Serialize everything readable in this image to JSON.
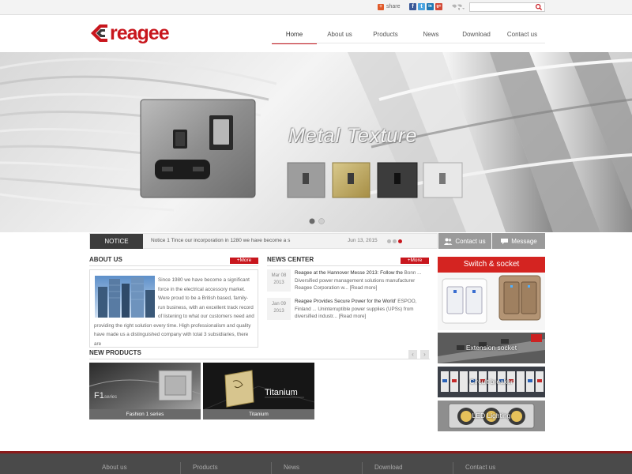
{
  "topbar": {
    "share_label": "share",
    "social": [
      {
        "name": "facebook",
        "glyph": "f",
        "color": "#3b5998"
      },
      {
        "name": "twitter",
        "glyph": "t",
        "color": "#4aa3df"
      },
      {
        "name": "linkedin",
        "glyph": "in",
        "color": "#1f78b4"
      },
      {
        "name": "google-plus",
        "glyph": "g+",
        "color": "#d34836"
      }
    ],
    "search_placeholder": ""
  },
  "header": {
    "logo_text": "reagee",
    "nav": [
      {
        "label": "Home",
        "active": true
      },
      {
        "label": "About us",
        "active": false
      },
      {
        "label": "Products",
        "active": false
      },
      {
        "label": "News",
        "active": false
      },
      {
        "label": "Download",
        "active": false
      },
      {
        "label": "Contact us",
        "active": false
      }
    ]
  },
  "banner": {
    "title": "Metal Texture",
    "slide_active": 1,
    "slide_count": 2
  },
  "notice": {
    "label": "NOTICE",
    "text": "Notice 1 Tince our incorporation in 1280 we have become a s",
    "date": "Jun 13, 2015",
    "contact_label": "Contact us",
    "message_label": "Message"
  },
  "about": {
    "title": "ABOUT US",
    "more": "+More",
    "text": "Since 1980 we have become a significant force in the electrical accessory market. Were proud to be a British based, family-run business, with an excellent track record of listening to what our customers need and providing the right solution every time. High professionalism and quality have made us a distinguished company with total 3 subsidiaries, there are"
  },
  "news": {
    "title": "NEWS CENTER",
    "more": "+More",
    "items": [
      {
        "date_md": "Mar 08",
        "year": "2013",
        "title": "Reagee at the Hannover Messe 2013: Follow the",
        "body": "Bonn ... Diversified power management solutions manufacturer Reagee Corporation w...",
        "read_more": "[Read more]"
      },
      {
        "date_md": "Jan 09",
        "year": "2013",
        "title": "Reagee Provides Secure Power for the World'",
        "body": "ESPOO, Finland ... Uninterruptible power supplies (UPSs) from diversified industr...",
        "read_more": "[Read more]"
      }
    ]
  },
  "products": {
    "title": "NEW PRODUCTS",
    "arrow_left": "‹",
    "arrow_right": "›",
    "items": [
      {
        "caption": "Fashion 1 series",
        "overlay": "F1",
        "overlay_small": "series"
      },
      {
        "caption": "Titanium",
        "overlay": "Titanium"
      }
    ]
  },
  "side": {
    "switch_title": "Switch & socket",
    "tiles": [
      "Extension socket",
      "Circuit breaker",
      "LED Lighting"
    ]
  },
  "footer": {
    "links": [
      "About us",
      "Products",
      "News",
      "Download",
      "Contact us"
    ]
  },
  "colors": {
    "brand_red": "#c8161d",
    "dark": "#3c3c3c"
  }
}
